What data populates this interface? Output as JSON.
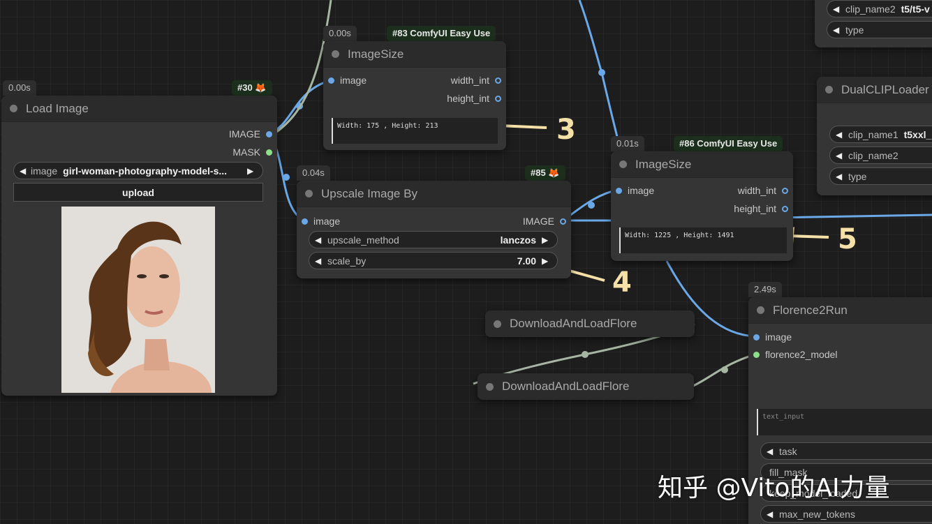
{
  "colors": {
    "canvas": "#1d1d1d",
    "node_body": "#353535",
    "node_title": "#2b2b2b",
    "wire_image": "#6aa8e8",
    "wire_other": "#a7b5a3",
    "annotation": "#f5e0a8"
  },
  "load_image": {
    "time": "0.00s",
    "tag": "#30",
    "tag_icon": "fox-icon",
    "title": "Load Image",
    "out_image": "IMAGE",
    "out_mask": "MASK",
    "image_label": "image",
    "image_value": "girl-woman-photography-model-s...",
    "upload_label": "upload"
  },
  "imagesize_83": {
    "time": "0.00s",
    "tag": "#83 ComfyUI Easy Use",
    "title": "ImageSize",
    "in_image": "image",
    "out_width": "width_int",
    "out_height": "height_int",
    "output_text": "Width: 175 , Height: 213"
  },
  "upscale_85": {
    "time": "0.04s",
    "tag": "#85",
    "tag_icon": "fox-icon",
    "title": "Upscale Image By",
    "in_image": "image",
    "out_image": "IMAGE",
    "method_label": "upscale_method",
    "method_value": "lanczos",
    "scale_label": "scale_by",
    "scale_value": "7.00"
  },
  "imagesize_86": {
    "time": "0.01s",
    "tag": "#86 ComfyUI Easy Use",
    "title": "ImageSize",
    "in_image": "image",
    "out_width": "width_int",
    "out_height": "height_int",
    "output_text": "Width: 1225 , Height: 1491"
  },
  "download_1": {
    "title": "DownloadAndLoadFlore"
  },
  "download_2": {
    "title": "DownloadAndLoadFlore"
  },
  "florence": {
    "time": "2.49s",
    "title": "Florence2Run",
    "in_image": "image",
    "in_model": "florence2_model",
    "text_input_placeholder": "text_input",
    "task_label": "task",
    "fill_mask_label": "fill_mask",
    "keep_model_label": "keep_model_loaded",
    "max_tokens_label": "max_new_tokens"
  },
  "clip_top": {
    "clip_name2_label": "clip_name2",
    "clip_name2_value": "t5/t5-v",
    "type_label": "type"
  },
  "dual_clip": {
    "title": "DualCLIPLoader",
    "clip_name1_label": "clip_name1",
    "clip_name1_value": "t5xxl_",
    "clip_name2_label": "clip_name2",
    "type_label": "type"
  },
  "markers": {
    "m3": "3",
    "m4": "4",
    "m5": "5"
  },
  "watermark": "知乎 @Vito的AI力量"
}
